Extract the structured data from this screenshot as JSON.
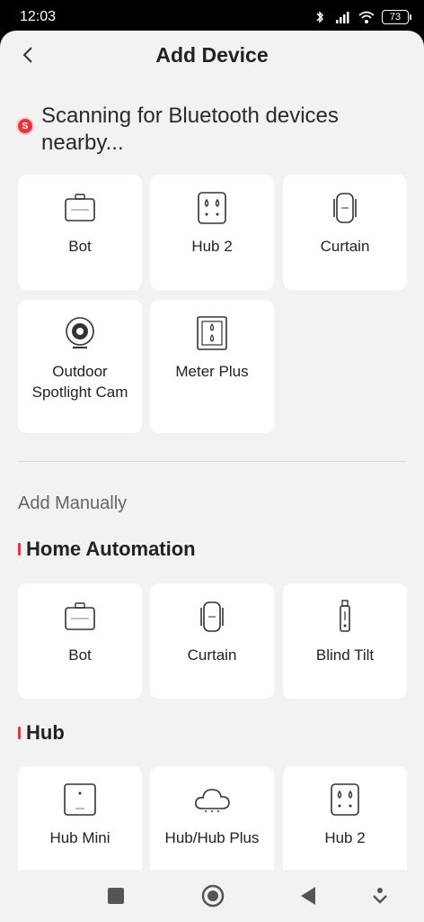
{
  "status_bar": {
    "time": "12:03",
    "battery": "73"
  },
  "header": {
    "title": "Add Device"
  },
  "scan": {
    "badge": "S",
    "text": "Scanning for Bluetooth devices nearby..."
  },
  "nearby_devices": [
    {
      "label": "Bot",
      "icon": "bot-icon"
    },
    {
      "label": "Hub 2",
      "icon": "hub2-icon"
    },
    {
      "label": "Curtain",
      "icon": "curtain-icon"
    },
    {
      "label": "Outdoor Spotlight Cam",
      "icon": "camera-icon"
    },
    {
      "label": "Meter Plus",
      "icon": "meter-icon"
    }
  ],
  "manual": {
    "heading": "Add Manually",
    "sections": [
      {
        "title": "Home Automation",
        "devices": [
          {
            "label": "Bot",
            "icon": "bot-icon"
          },
          {
            "label": "Curtain",
            "icon": "curtain-icon"
          },
          {
            "label": "Blind Tilt",
            "icon": "blind-tilt-icon"
          }
        ]
      },
      {
        "title": "Hub",
        "devices": [
          {
            "label": "Hub Mini",
            "icon": "hub-mini-icon"
          },
          {
            "label": "Hub/Hub Plus",
            "icon": "cloud-icon"
          },
          {
            "label": "Hub 2",
            "icon": "hub2-icon"
          }
        ]
      }
    ]
  },
  "colors": {
    "accent": "#e2363f",
    "background": "#f2f2f2",
    "card": "#ffffff"
  }
}
